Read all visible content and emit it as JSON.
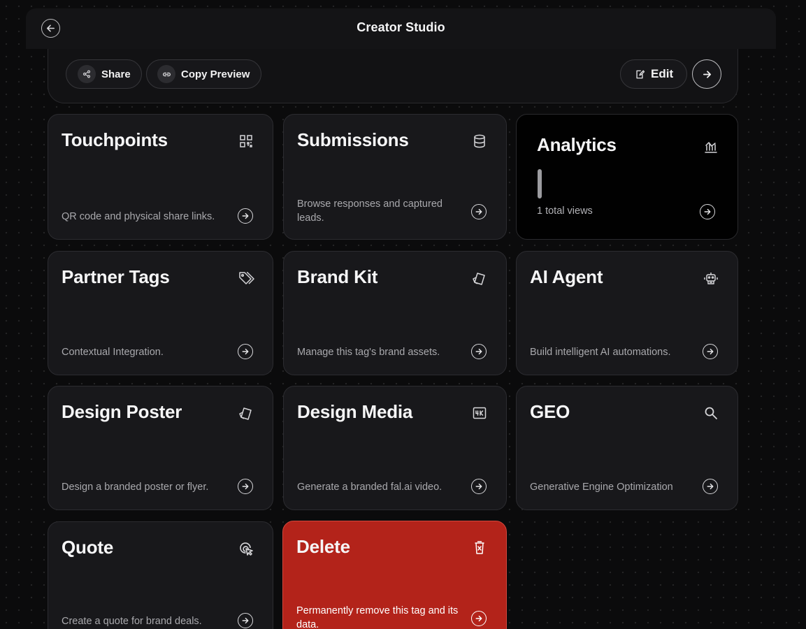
{
  "window": {
    "title": "Creator Studio",
    "back_icon": "arrow-left-icon"
  },
  "actions": {
    "share_label": "Share",
    "copy_preview_label": "Copy Preview",
    "edit_label": "Edit"
  },
  "cards": [
    {
      "title": "Touchpoints",
      "description": "QR code and physical share links.",
      "icon": "qr-code-icon"
    },
    {
      "title": "Submissions",
      "description": "Browse responses and captured leads.",
      "icon": "database-icon"
    },
    {
      "title": "Analytics",
      "description": "1 total views",
      "icon": "chart-icon"
    },
    {
      "title": "Partner Tags",
      "description": "Contextual Integration.",
      "icon": "tags-icon"
    },
    {
      "title": "Brand Kit",
      "description": "Manage this tag's brand assets.",
      "icon": "swatch-icon"
    },
    {
      "title": "AI Agent",
      "description": "Build intelligent AI automations.",
      "icon": "robot-icon"
    },
    {
      "title": "Design Poster",
      "description": "Design a branded poster or flyer.",
      "icon": "swatch-icon"
    },
    {
      "title": "Design Media",
      "description": "Generate a branded fal.ai video.",
      "icon": "4k-icon"
    },
    {
      "title": "GEO",
      "description": "Generative Engine Optimization",
      "icon": "search-icon"
    },
    {
      "title": "Quote",
      "description": "Create a quote for brand deals.",
      "icon": "cursor-click-icon"
    },
    {
      "title": "Delete",
      "description": "Permanently remove this tag and its data.",
      "icon": "trash-icon"
    }
  ],
  "colors": {
    "danger": "#b3231a",
    "background": "#0b0b0c",
    "card": "#18181b"
  }
}
